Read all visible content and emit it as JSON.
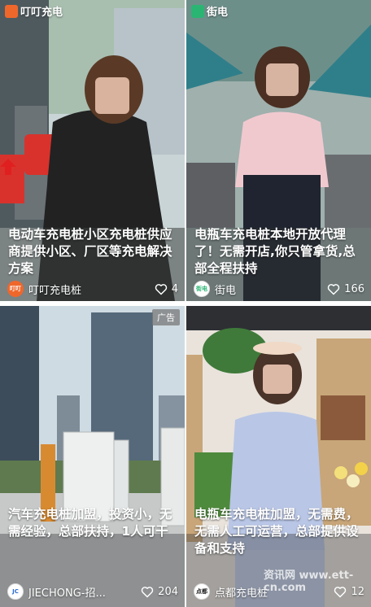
{
  "feed": {
    "cards": [
      {
        "brand": "叮叮充电",
        "caption": "电动车充电桩小区充电桩供应商提供小区、厂区等充电解决方案",
        "author": "叮叮充电桩",
        "likes": "4",
        "avatar_text": "叮叮"
      },
      {
        "brand": "街电",
        "caption": "电瓶车充电桩本地开放代理了！无需开店,你只管拿货,总部全程扶持",
        "author": "街电",
        "likes": "166",
        "avatar_text": "街电"
      },
      {
        "ad_label": "广告",
        "caption": "汽车充电桩加盟，投资小，无需经验，总部扶持，1人可干",
        "author": "JIECHONG-招...",
        "likes": "204",
        "avatar_text": "JC"
      },
      {
        "caption": "电瓶车充电桩加盟，无需费，无需人工可运营，总部提供设备和支持",
        "author": "点都充电桩",
        "likes": "12",
        "avatar_text": "点都",
        "watermark": "资讯网 www.ett-cn.com"
      }
    ]
  },
  "colors": {
    "like_icon": "#ffffff",
    "brand_orange": "#f0672b",
    "brand_green": "#2bb573"
  },
  "icons": {
    "like": "heart-outline-icon"
  }
}
